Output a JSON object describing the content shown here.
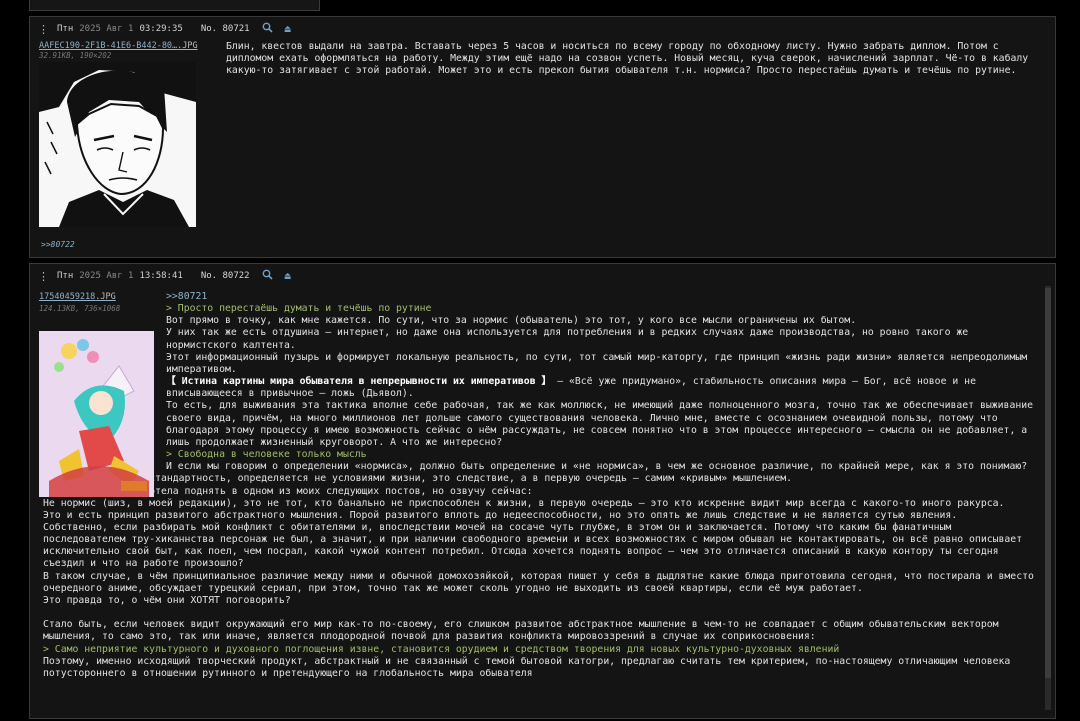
{
  "posts": [
    {
      "day": "Птн",
      "date": "2025 Авг 1",
      "time": "03:29:35",
      "number_label": "No. 80721",
      "file_name": "AAFEC190-2F1B-41E6-B442-80…",
      "file_ext": ".JPG",
      "file_size": "32.91KB, 190×202",
      "reply_link": ">>80722",
      "text": "Блин, квестов выдали на завтра. Вставать через 5 часов и носиться по всему городу по обходному листу. Нужно забрать диплом. Потом с дипломом ехать оформляться на работу. Между этим ещё надо на созвон успеть. Новый месяц, куча сверок, начислений зарплат. Чё-то в кабалу какую-то затягивает с этой работай. Может это и есть прекол бытия обывателя т.н. нормиса? Просто перестаёшь думать и течёшь по рутине."
    },
    {
      "day": "Птн",
      "date": "2025 Авг 1",
      "time": "13:58:41",
      "number_label": "No. 80722",
      "file_name": "17540459218",
      "file_ext": ".JPG",
      "file_size": "124.13KB, 736×1068",
      "reply_to": ">>80721",
      "quote1": "> Просто перестаёшь думать и течёшь по рутине",
      "p1": "Вот прямо в точку, как мне кажется. По сути, что за нормис (обыватель) это тот, у кого все мысли ограничены их бытом.",
      "p2": "У них так же есть отдушина – интернет, но даже она используется для потребления и в редких случаях даже производства, но ровно такого же нормистского калтента.",
      "p3": "Этот информационный пузырь и формирует локальную реальность, по сути, тот самый мир-каторгу, где принцип «жизнь ради жизни» является непреодолимым императивом.",
      "bold": "【 Истина картины мира обывателя в непрерывности их императивов 】",
      "p4": " – «Всё уже придумано», стабильность описания мира  – Бог, всё новое и не вписывающееся в привычное – ложь (Дьявол).",
      "p5": "То есть, для выживания эта тактика вполне себе рабочая, так же как моллюск, не имеющий даже полноценного мозга, точно так же обеспечивает выживание своего вида, причём, на много миллионов лет дольше самого существования человека. Лично мне, вместе с осознанием очевидной пользы, потому что благодаря этому процессу я имею возможность сейчас о нём рассуждать, не совсем понятно что в этом процессе интересного – смысла он не добавляет, а лишь продолжает жизненный круговорот. А что же интересно?",
      "quote2": "> Свободна в человеке только мысль",
      "p6": "И если мы говорим о определении «нормиса», должно быть определение и «не нормиса», в чем же основное различие, по крайней мере, как я это понимаю? Ненормальность, нестандартность, определяется не условиями жизни, это следствие, а в первую очередь – самим «кривым» мышлением.",
      "p7": "Тезис, который я хотела поднять в одном из моих следующих постов, но озвучу сейчас:",
      "p8": "Не нормис (шиз, в моей редакции), это не тот, кто банально не приспособлен к жизни, в первую очередь – это кто искренне видит мир всегда с какого-то иного ракурса.",
      "p9": "Это и есть принцип развитого абстрактного мышления. Порой развитого вплоть до недееспособности, но это опять же лишь следствие и не является сутью явления.",
      "p10": "Собственно, если разбирать мой конфликт с обитателями и, впоследствии мочей на сосаче чуть глубже, в этом он и заключается. Потому что каким бы фанатичным последователем тру-хиканнства персонаж не был, а значит, и при наличии свободного времени и всех возможностях с миром обывал не контактировать, он всё равно описывает исключительно свой быт, как поел, чем посрал, какой чужой контент потребил. Отсюда хочется поднять вопрос – чем это отличается описаний в какую контору ты сегодня съездил и что на работе произошло?",
      "p11": "В таком случае, в чём принципиальное различие между ними и обычной домохозяйкой, которая пишет у себя в дыдлятне какие блюда приготовила сегодня, что постирала и вместо очередного аниме, обсуждает турецкий сериал, при этом, точно так же может сколь угодно не выходить из своей квартиры, если её муж работает.",
      "p12": "Это правда то, о чём они ХОТЯТ поговорить?",
      "p13": "Стало быть, если человек видит окружающий его мир как-то по-своему, его слишком развитое абстрактное мышление в чем-то не совпадает с общим обывательским вектором мышления, то само это, так или иначе, является плодородной почвой для развития конфликта мировоззрений в случае их соприкосновения:",
      "quote3": "> Само неприятие культурного и духовного поглощения извне, становится орудием и средством творения для новых культурно-духовных явлений",
      "p14": "Поэтому, именно исходящий творческий продукт, абстрактный и не связанный с темой бытовой катогри, предлагаю считать тем критерием, по-настоящему отличающим человека потустороннего в отношении рутинного и претендующего на глобальность мира обывателя"
    }
  ],
  "icons": {
    "menu": "dots-vertical-icon",
    "search": "magnifier-icon",
    "eject": "eject-icon"
  },
  "colors": {
    "background": "#000000",
    "post_bg": "#141414",
    "link": "#8fb2c8",
    "quote": "#a2be6a",
    "text": "#e2e2e2"
  }
}
